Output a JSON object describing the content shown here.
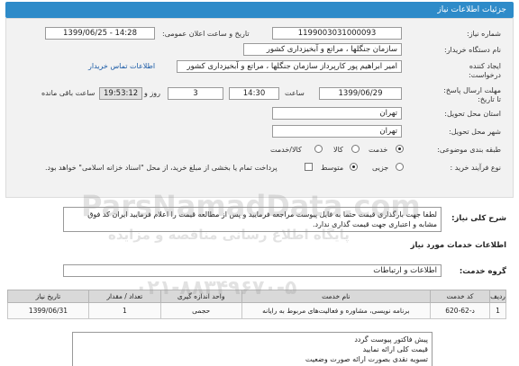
{
  "page": {
    "title": "جزئیات اطلاعات نیاز"
  },
  "form": {
    "need_number_label": "شماره نیاز:",
    "need_number": "1199003031000093",
    "announce_label": "تاریخ و ساعت اعلان عمومی:",
    "announce_value": "1399/06/25 - 14:28",
    "buyer_label": "نام دستگاه خریدار:",
    "buyer_value": "سازمان جنگلها ، مراتع و آبخیزداری کشور",
    "creator_label": "ایجاد کننده درخواست:",
    "creator_value": "امیر  ابراهیم پور کارپرداز سازمان جنگلها ، مراتع و آبخیزداری کشور",
    "contact_link": "اطلاعات تماس خریدار",
    "deadline_label": "مهلت ارسال پاسخ: تا تاریخ:",
    "deadline_date": "1399/06/29",
    "time_label": "ساعت",
    "deadline_time": "14:30",
    "days_value": "3",
    "days_label": "روز و",
    "remaining_time": "19:53:12",
    "remaining_label": "ساعت باقی مانده",
    "province_label": "استان محل تحویل:",
    "province_value": "تهران",
    "city_label": "شهر محل تحویل:",
    "city_value": "تهران",
    "category_label": "طبقه بندی موضوعی:",
    "category_options": [
      "کالا",
      "کالا/خدمت"
    ],
    "category_selected": "خدمت",
    "process_label": "نوع فرآیند خرید :",
    "process_options": [
      "جزیی",
      "متوسط"
    ],
    "payment_note": "پرداخت تمام یا بخشی از مبلغ خرید، از محل \"اسناد خزانه اسلامی\" خواهد بود."
  },
  "description": {
    "title": "شرح کلی نیاز:",
    "text": "لطفا جهت بارگذاری قیمت حتما به فایل پیوست مراجعه فرمایید و پس از مطالعه قیمت را اعلام فرمایید ایران کد فوق مشابه و اعتباری جهت قیمت گذاری ندارد."
  },
  "services": {
    "section_title": "اطلاعات خدمات مورد نیاز",
    "group_label": "گروه خدمت:",
    "group_value": "اطلاعات و ارتباطات",
    "columns": [
      "ردیف",
      "کد خدمت",
      "نام خدمت",
      "واحد اندازه گیری",
      "تعداد / مقدار",
      "تاریخ نیاز"
    ],
    "rows": [
      {
        "index": "1",
        "code": "د-62-620",
        "name": "برنامه نویسی، مشاوره و فعالیت‌های مربوط به رایانه",
        "unit": "حجمی",
        "qty": "1",
        "date": "1399/06/31"
      }
    ]
  },
  "notes": {
    "lines": [
      "پیش فاکتور پیوست گردد",
      "قیمت کلی ارائه نمایید",
      "تسویه نقدی بصورت ارائه صورت وضعیت"
    ]
  },
  "watermark": {
    "site": "ParsNamadData.com",
    "line1": "پایگاه اطلاع رسانی مناقصه و مزایده",
    "phone": "۰۲۱-۸۸۳۴۹۶۷۰-۵"
  }
}
